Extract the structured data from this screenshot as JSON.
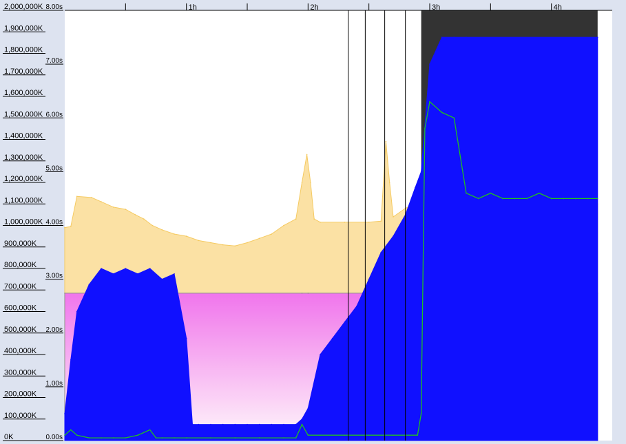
{
  "chart_data": {
    "type": "area",
    "title": "",
    "x": {
      "unit": "hours",
      "range": [
        0,
        4.5
      ],
      "ticks": [
        0.5,
        1,
        1.5,
        2,
        2.5,
        3,
        3.5,
        4
      ],
      "tick_labels": [
        "",
        "1h",
        "",
        "2h",
        "",
        "3h",
        "",
        "4h"
      ]
    },
    "y_left": {
      "unit": "K",
      "range": [
        0,
        2000000
      ],
      "ticks": [
        0,
        100000,
        200000,
        300000,
        400000,
        500000,
        600000,
        700000,
        800000,
        900000,
        1000000,
        1100000,
        1200000,
        1300000,
        1400000,
        1500000,
        1600000,
        1700000,
        1800000,
        1900000,
        2000000
      ],
      "tick_labels": [
        "0K",
        "100,000K",
        "200,000K",
        "300,000K",
        "400,000K",
        "500,000K",
        "600,000K",
        "700,000K",
        "800,000K",
        "900,000K",
        "1,000,000K",
        "1,100,000K",
        "1,200,000K",
        "1,300,000K",
        "1,400,000K",
        "1,500,000K",
        "1,600,000K",
        "1,700,000K",
        "1,800,000K",
        "1,900,000K",
        "2,000,000K"
      ]
    },
    "y_right": {
      "unit": "s",
      "range": [
        0,
        8
      ],
      "ticks": [
        0,
        1,
        2,
        3,
        4,
        5,
        6,
        7,
        8
      ],
      "tick_labels": [
        "0.00s",
        "1.00s",
        "2.00s",
        "3.00s",
        "4.00s",
        "5.00s",
        "6.00s",
        "7.00s",
        "8.00s"
      ]
    },
    "shaded_region": {
      "x_range": [
        2.93,
        4.38
      ],
      "color": "#333333"
    },
    "markers": {
      "x": [
        2.33,
        2.47,
        2.63,
        2.8
      ]
    },
    "series": [
      {
        "color": "#f5c85a",
        "fill": "#fbe0a0",
        "axis": "left",
        "style": "area",
        "x": [
          0,
          0.05,
          0.1,
          0.22,
          0.3,
          0.4,
          0.5,
          0.58,
          0.65,
          0.72,
          0.8,
          0.9,
          1.0,
          1.1,
          1.2,
          1.3,
          1.4,
          1.5,
          1.6,
          1.7,
          1.8,
          1.9,
          1.95,
          1.99,
          2.02,
          2.05,
          2.1,
          2.3,
          2.5,
          2.6,
          2.64,
          2.67,
          2.7,
          2.8,
          2.88,
          2.93,
          4.38
        ],
        "y": [
          990000,
          995000,
          1135000,
          1130000,
          1110000,
          1085000,
          1075000,
          1050000,
          1030000,
          1000000,
          980000,
          960000,
          950000,
          930000,
          920000,
          910000,
          905000,
          920000,
          940000,
          960000,
          1000000,
          1030000,
          1200000,
          1330000,
          1200000,
          1030000,
          1015000,
          1015000,
          1015000,
          1020000,
          1390000,
          1200000,
          1040000,
          1080000,
          1100000,
          1100000,
          1100000
        ]
      },
      {
        "color": "#8a8a8a",
        "fill": "#f070f0",
        "axis": "left",
        "style": "area",
        "x": [
          0,
          1.95,
          2.0,
          2.93,
          4.38
        ],
        "y": [
          685000,
          685000,
          685000,
          685000,
          685000
        ]
      },
      {
        "color": "#1010ff",
        "fill": "#1010ff",
        "axis": "right",
        "style": "area",
        "x": [
          0,
          0.05,
          0.1,
          0.2,
          0.3,
          0.4,
          0.5,
          0.6,
          0.7,
          0.8,
          0.9,
          1.0,
          1.05,
          1.1,
          1.2,
          1.3,
          1.4,
          1.5,
          1.6,
          1.7,
          1.8,
          1.9,
          1.95,
          2.0,
          2.1,
          2.2,
          2.3,
          2.4,
          2.5,
          2.6,
          2.7,
          2.8,
          2.88,
          2.93,
          3.0,
          3.1,
          3.2,
          3.3,
          4.38
        ],
        "y": [
          0.5,
          1.5,
          2.4,
          2.9,
          3.2,
          3.1,
          3.2,
          3.1,
          3.2,
          3.0,
          3.1,
          1.9,
          0.3,
          0.3,
          0.3,
          0.3,
          0.3,
          0.3,
          0.3,
          0.3,
          0.3,
          0.3,
          0.4,
          0.6,
          1.6,
          1.9,
          2.2,
          2.5,
          3.0,
          3.5,
          3.8,
          4.2,
          4.7,
          5.0,
          7.0,
          7.5,
          7.5,
          7.5,
          7.5
        ]
      },
      {
        "color": "#20c020",
        "axis": "right",
        "style": "line",
        "x": [
          0,
          0.05,
          0.1,
          0.2,
          0.3,
          0.4,
          0.5,
          0.6,
          0.7,
          0.75,
          0.8,
          0.9,
          1.0,
          1.2,
          1.4,
          1.6,
          1.8,
          1.9,
          1.95,
          2.0,
          2.1,
          2.3,
          2.5,
          2.7,
          2.9,
          2.93,
          2.96,
          3.0,
          3.1,
          3.2,
          3.3,
          3.4,
          3.5,
          3.6,
          3.7,
          3.8,
          3.9,
          4.0,
          4.1,
          4.2,
          4.3,
          4.38
        ],
        "y": [
          0.1,
          0.2,
          0.1,
          0.05,
          0.05,
          0.05,
          0.05,
          0.1,
          0.2,
          0.05,
          0.05,
          0.05,
          0.05,
          0.05,
          0.05,
          0.05,
          0.05,
          0.05,
          0.3,
          0.1,
          0.1,
          0.1,
          0.1,
          0.1,
          0.1,
          0.5,
          5.8,
          6.3,
          6.1,
          6.0,
          4.6,
          4.5,
          4.6,
          4.5,
          4.5,
          4.5,
          4.6,
          4.5,
          4.5,
          4.5,
          4.5,
          4.5
        ]
      }
    ]
  }
}
